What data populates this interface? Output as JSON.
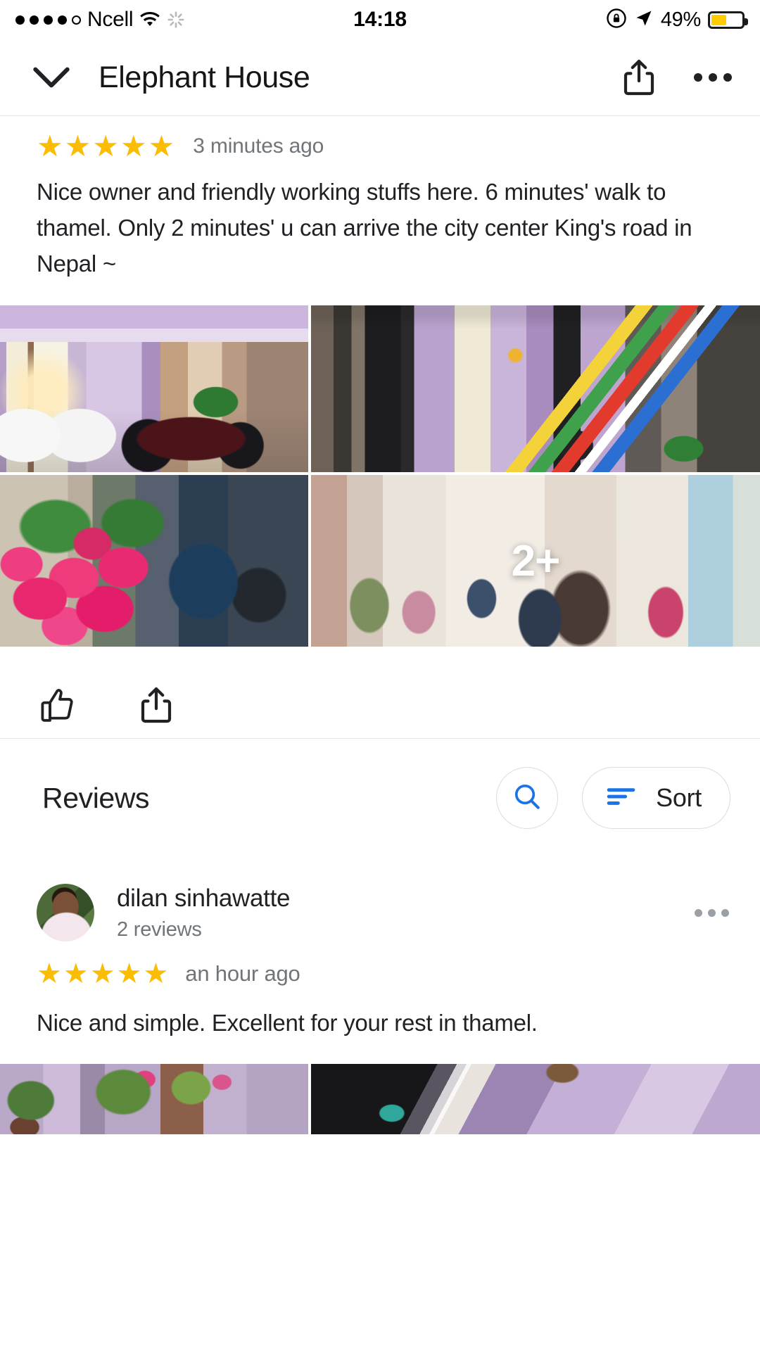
{
  "status_bar": {
    "signal_dots_filled": 4,
    "signal_dots_total": 5,
    "carrier": "Ncell",
    "wifi_icon": "wifi-icon",
    "activity_icon": "spinner-icon",
    "time": "14:18",
    "rotation_lock_icon": "rotation-lock-icon",
    "location_icon": "location-arrow-icon",
    "battery_percent": "49%",
    "battery_level": 49,
    "battery_color": "#ffcc00"
  },
  "header": {
    "back_icon": "chevron-down-icon",
    "title": "Elephant House",
    "share_icon": "share-icon",
    "overflow_icon": "more-horizontal-icon"
  },
  "top_review": {
    "rating": 5,
    "stars": "★★★★★",
    "time_ago": "3 minutes ago",
    "text": "Nice owner and friendly working stuffs here.  6 minutes' walk to thamel. Only 2 minutes' u can arrive the city center King's road in Nepal ~",
    "photos": [
      {
        "name": "photo-purple-house-porch",
        "alt": "Purple house porch with white chairs and motorbike"
      },
      {
        "name": "photo-purple-wall-prayer-flags",
        "alt": "Purple building wall with black grills and prayer flags"
      },
      {
        "name": "photo-pink-flowers",
        "alt": "Pink roses in front of stone wall with blue motorbike"
      },
      {
        "name": "photo-group-selfie",
        "alt": "Group of people smiling indoors"
      }
    ],
    "more_photos_badge": "2+",
    "like_icon": "thumbs-up-icon",
    "share_icon": "share-icon"
  },
  "reviews_section": {
    "title": "Reviews",
    "search_icon": "search-icon",
    "search_icon_color": "#1a73e8",
    "sort_icon": "sort-lines-icon",
    "sort_icon_color": "#1a73e8",
    "sort_label": "Sort"
  },
  "review_list": [
    {
      "avatar": "user-avatar",
      "name": "dilan sinhawatte",
      "review_count": "2 reviews",
      "overflow_icon": "more-horizontal-icon",
      "rating": 5,
      "stars": "★★★★★",
      "time_ago": "an hour ago",
      "text": "Nice and simple. Excellent for your rest in thamel.",
      "photos": [
        {
          "name": "photo-courtyard-plants",
          "alt": "Purple courtyard with potted plants"
        },
        {
          "name": "photo-purple-building-window",
          "alt": "Purple building exterior with open window"
        }
      ]
    }
  ],
  "colors": {
    "star_gold": "#fbbc04",
    "accent_blue": "#1a73e8",
    "text_primary": "#202124",
    "text_secondary": "#70757a",
    "border": "#dadce0"
  }
}
